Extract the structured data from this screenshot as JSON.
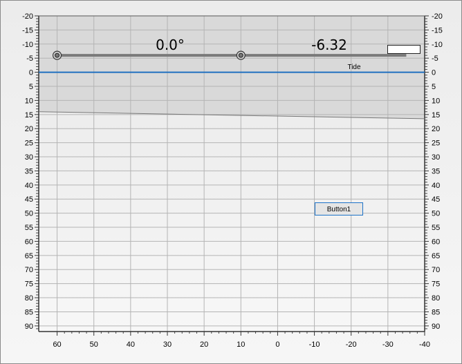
{
  "axes": {
    "y_ticks": [
      -20,
      -15,
      -10,
      -5,
      0,
      5,
      10,
      15,
      20,
      25,
      30,
      35,
      40,
      45,
      50,
      55,
      60,
      65,
      70,
      75,
      80,
      85,
      90
    ],
    "x_ticks": [
      60,
      50,
      40,
      30,
      20,
      10,
      0,
      -10,
      -20,
      -30,
      -40
    ],
    "x_range": [
      65,
      -40
    ],
    "y_range": [
      -20,
      92
    ]
  },
  "tide": {
    "label": "Tide",
    "level": 0,
    "color": "#1f6fc0"
  },
  "angle_label": "0.0°",
  "depth_label": "-6.32",
  "slider": {
    "y": -6,
    "handle1_x": 60,
    "handle2_x": 10,
    "end_x": -35
  },
  "seabed": {
    "start_y": 14,
    "end_y": 16.5
  },
  "button1": {
    "label": "Button1"
  },
  "value_box": {
    "value": ""
  },
  "colors": {
    "upper_region": "#d9d9d9",
    "lower_region": "#ededed",
    "grid": "#b4b4b4",
    "accent": "#1c72c8"
  }
}
